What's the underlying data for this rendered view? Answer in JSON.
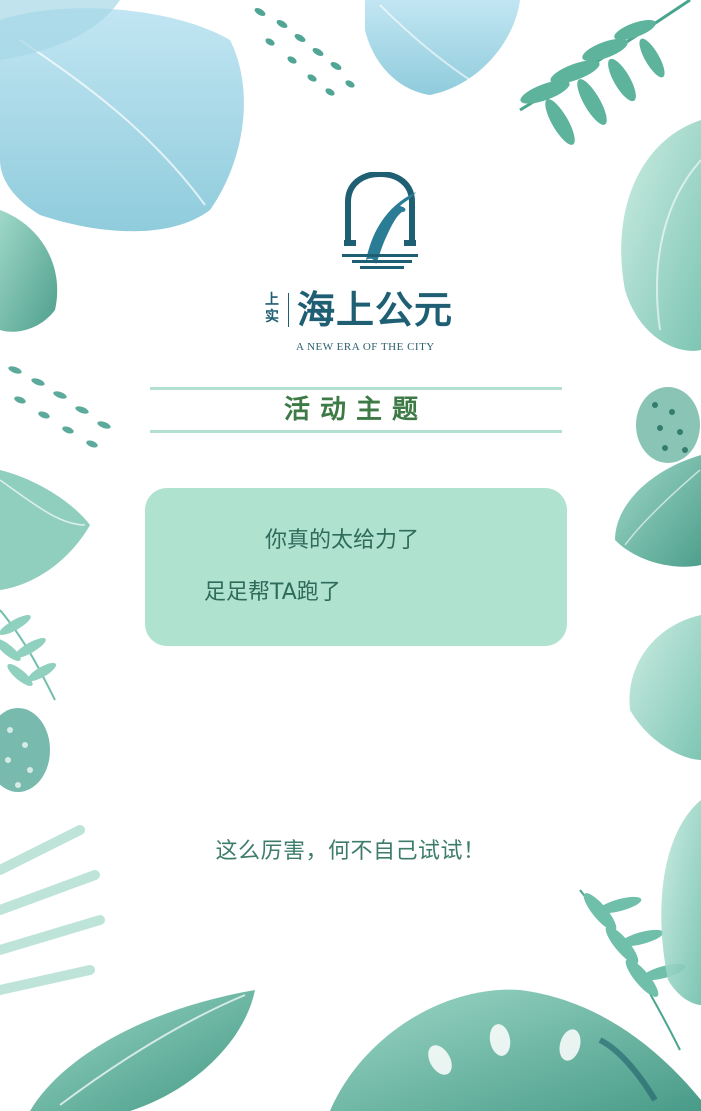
{
  "brand": {
    "sub_label_top": "上",
    "sub_label_bottom": "实",
    "name": "海上公元",
    "tagline": "A NEW ERA OF THE CITY"
  },
  "theme": {
    "title": "活动主题"
  },
  "card": {
    "line1": "你真的太给力了",
    "line2": "足足帮TA跑了"
  },
  "cta": {
    "text": "这么厉害，何不自己试试！"
  },
  "colors": {
    "brand": "#1e5f74",
    "leaf_dark": "#3f9c8a",
    "leaf_light": "#a9dccd",
    "card_bg": "#b0e2d0",
    "theme_text": "#3d7a45",
    "body_text": "#2f6b5a"
  }
}
